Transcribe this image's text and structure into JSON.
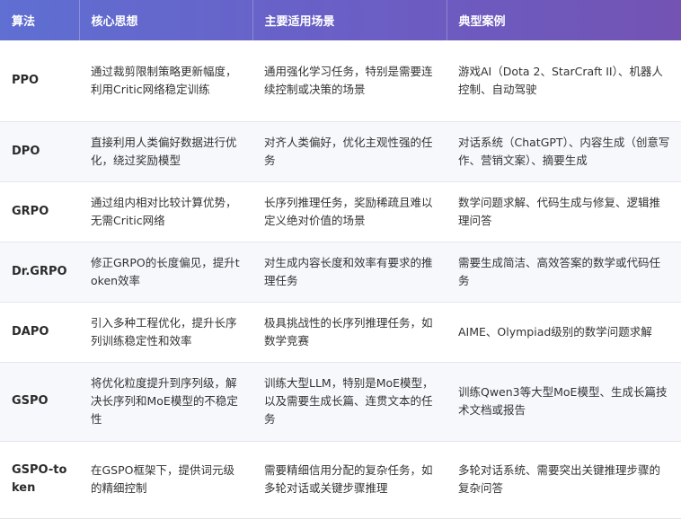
{
  "header": {
    "col1": "算法",
    "col2": "核心思想",
    "col3": "主要适用场景",
    "col4": "典型案例"
  },
  "rows": [
    {
      "algo": "PPO",
      "idea": "通过裁剪限制策略更新幅度，利用Critic网络稳定训练",
      "scene": "通用强化学习任务，特别是需要连续控制或决策的场景",
      "case": "游戏AI（Dota 2、StarCraft II）、机器人控制、自动驾驶"
    },
    {
      "algo": "DPO",
      "idea": "直接利用人类偏好数据进行优化，绕过奖励模型",
      "scene": "对齐人类偏好，优化主观性强的任务",
      "case": "对话系统（ChatGPT）、内容生成（创意写作、营销文案）、摘要生成"
    },
    {
      "algo": "GRPO",
      "idea": "通过组内相对比较计算优势，无需Critic网络",
      "scene": "长序列推理任务，奖励稀疏且难以定义绝对价值的场景",
      "case": "数学问题求解、代码生成与修复、逻辑推理问答"
    },
    {
      "algo": "Dr.GRPO",
      "idea": "修正GRPO的长度偏见，提升token效率",
      "scene": "对生成内容长度和效率有要求的推理任务",
      "case": "需要生成简洁、高效答案的数学或代码任务"
    },
    {
      "algo": "DAPO",
      "idea": "引入多种工程优化，提升长序列训练稳定性和效率",
      "scene": "极具挑战性的长序列推理任务，如数学竞赛",
      "case": "AIME、Olympiad级别的数学问题求解"
    },
    {
      "algo": "GSPO",
      "idea": "将优化粒度提升到序列级，解决长序列和MoE模型的不稳定性",
      "scene": "训练大型LLM，特别是MoE模型，以及需要生成长篇、连贯文本的任务",
      "case": "训练Qwen3等大型MoE模型、生成长篇技术文档或报告"
    },
    {
      "algo": "GSPO-token",
      "idea": "在GSPO框架下，提供词元级的精细控制",
      "scene": "需要精细信用分配的复杂任务，如多轮对话或关键步骤推理",
      "case": "多轮对话系统、需要突出关键推理步骤的复杂问答"
    }
  ]
}
